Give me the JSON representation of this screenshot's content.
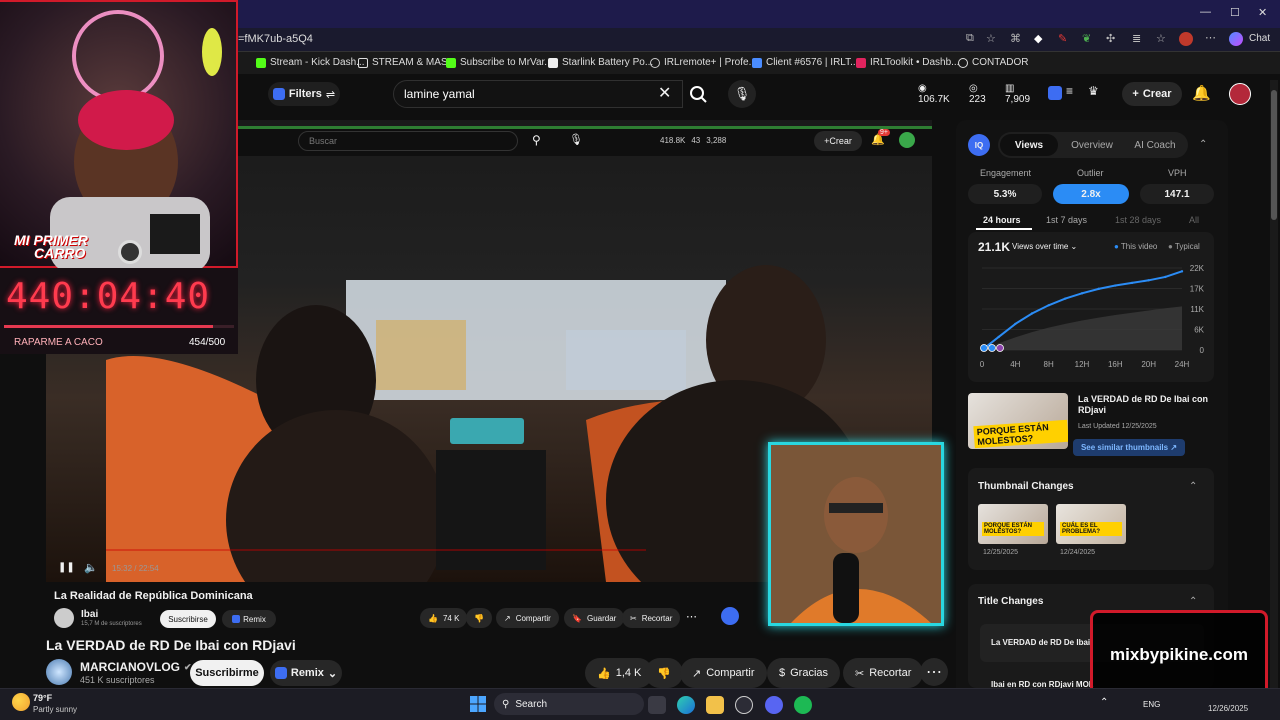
{
  "browser": {
    "url_fragment": "=fMK7ub-a5Q4",
    "chat_label": "Chat",
    "bookmarks": [
      {
        "label": "Stream - Kick Dash...",
        "color": "#53fc18"
      },
      {
        "label": "STREAM & MAS",
        "color": "#dddddd"
      },
      {
        "label": "Subscribe to MrVar...",
        "color": "#53fc18"
      },
      {
        "label": "Starlink Battery Po...",
        "color": "#eeeeee"
      },
      {
        "label": "IRLremote+ | Profe...",
        "color": "#cccccc"
      },
      {
        "label": "Client #6576 | IRLT...",
        "color": "#4a8cff"
      },
      {
        "label": "IRLToolkit • Dashb...",
        "color": "#e0245e"
      },
      {
        "label": "CONTADOR",
        "color": "#dddddd"
      }
    ]
  },
  "youtube_header": {
    "filters_label": "Filters",
    "search_value": "lamine yamal",
    "stats": [
      "106.7K",
      "223",
      "7,909"
    ],
    "create_label": "Crear"
  },
  "inner_screen": {
    "search_placeholder": "Buscar",
    "stats": [
      "418.8K",
      "43",
      "3,288"
    ],
    "create_label": "Crear",
    "notif_badge": "9+",
    "video_title": "La Realidad de República Dominicana",
    "channel": "Ibai",
    "subs": "15,7 M de suscriptores",
    "subscribe_label": "Suscribirse",
    "remix_label": "Remix",
    "likes": "74 K",
    "share_label": "Compartir",
    "save_label": "Guardar",
    "clip_label": "Recortar",
    "time": "15:32 / 22:54"
  },
  "stream_overlay": {
    "banner_line1": "MI PRIMER",
    "banner_line2": "CARRO",
    "timer": "440:04:40",
    "goal_label": "RAPARME A CACO",
    "goal_count": "454/500",
    "goal_progress": 0.908,
    "brand": "mixbypikine.com"
  },
  "video": {
    "title": "La VERDAD de RD De Ibai con RDjavi",
    "channel": "MARCIANOVLOG",
    "subs": "451 K suscriptores",
    "subscribe_label": "Suscribirme",
    "remix_label": "Remix",
    "likes": "1,4 K",
    "share_label": "Compartir",
    "thanks_label": "Gracias",
    "clip_label": "Recortar"
  },
  "panel": {
    "tabs": [
      "Views",
      "Overview",
      "AI Coach"
    ],
    "metric_labels": [
      "Engagement",
      "Outlier",
      "VPH"
    ],
    "metric_values": [
      "5.3%",
      "2.8x",
      "147.1"
    ],
    "ranges": [
      "24 hours",
      "1st 7 days",
      "1st 28 days",
      "All"
    ],
    "views_total": "21.1K",
    "views_select": "Views over time",
    "legend_this": "This video",
    "legend_typical": "Typical",
    "y_ticks": [
      "22K",
      "17K",
      "11K",
      "6K",
      "0"
    ],
    "x_ticks": [
      "0",
      "4H",
      "8H",
      "12H",
      "16H",
      "20H",
      "24H"
    ],
    "thumb_title": "La VERDAD de RD De Ibai con RDjavi",
    "last_updated": "Last Updated 12/25/2025",
    "similar_label": "See similar thumbnails",
    "thumb_changes_title": "Thumbnail Changes",
    "thumb_dates": [
      "12/25/2025",
      "12/24/2025"
    ],
    "title_changes_title": "Title Changes",
    "title_entries": [
      "La VERDAD de RD De Ibai",
      "Ibai en RD con RDjavi MOL"
    ],
    "thumb_text_1": "PORQUE ESTÁN MOLESTOS?",
    "thumb_text_2": "CUÁL ES EL PROBLEMA?"
  },
  "chart_data": {
    "type": "area",
    "x": [
      0,
      2,
      4,
      6,
      8,
      10,
      12,
      14,
      16,
      18,
      20,
      22,
      24
    ],
    "ylim": [
      0,
      22000
    ],
    "series": [
      {
        "name": "This video",
        "values": [
          0,
          3500,
          7000,
          9800,
          12000,
          13800,
          15200,
          16400,
          17300,
          18000,
          18700,
          19600,
          21100
        ]
      },
      {
        "name": "Typical",
        "values": [
          0,
          1800,
          3400,
          4800,
          6000,
          7000,
          7900,
          8700,
          9400,
          10000,
          10600,
          11200,
          11700
        ]
      }
    ],
    "yticks": [
      "22K",
      "17K",
      "11K",
      "6K",
      "0"
    ],
    "xticks": [
      "0",
      "4H",
      "8H",
      "12H",
      "16H",
      "20H",
      "24H"
    ],
    "legend": "top-right"
  },
  "taskbar": {
    "weather_temp": "79°F",
    "weather_desc": "Partly sunny",
    "search_label": "Search",
    "lang": "ENG",
    "date": "12/26/2025"
  }
}
